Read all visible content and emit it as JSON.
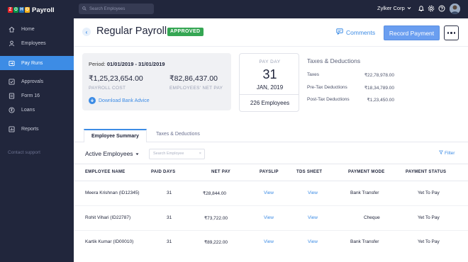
{
  "brand": {
    "logo_letters": [
      "Z",
      "O",
      "H",
      "O"
    ],
    "logo_colors": [
      "#e42527",
      "#089949",
      "#226db4",
      "#f9b21d"
    ],
    "product": "Payroll"
  },
  "sidebar": {
    "items": [
      {
        "label": "Home",
        "icon": "home-icon"
      },
      {
        "label": "Employees",
        "icon": "user-icon"
      },
      {
        "label": "Pay Runs",
        "icon": "payrun-icon",
        "active": true
      },
      {
        "label": "Approvals",
        "icon": "checkbox-icon"
      },
      {
        "label": "Form 16",
        "icon": "document-icon"
      },
      {
        "label": "Loans",
        "icon": "rupee-icon"
      },
      {
        "label": "Reports",
        "icon": "chart-icon"
      }
    ],
    "contact": "Contact support"
  },
  "topbar": {
    "search_placeholder": "Search Employees",
    "org_name": "Zylker Corp"
  },
  "header": {
    "title": "Regular Payroll",
    "status": "APPROVED",
    "comments": "Comments",
    "record_payment": "Record Payment"
  },
  "summary": {
    "period_label": "Period:",
    "period_value": "01/01/2019 - 31/01/2019",
    "payroll_cost": "₹1,25,23,654.00",
    "payroll_cost_label": "PAYROLL COST",
    "net_pay": "₹82,86,437.00",
    "net_pay_label": "EMPLOYEES' NET PAY",
    "download_advice": "Download Bank Advice"
  },
  "payday": {
    "label": "PAY DAY",
    "day": "31",
    "month_year": "JAN, 2019",
    "employees": "226 Employees"
  },
  "taxes": {
    "title": "Taxes & Deductions",
    "rows": [
      {
        "label": "Taxes",
        "value": "₹22,78,978.00"
      },
      {
        "label": "Pre-Tax Deductions",
        "value": "₹18,34,789.00"
      },
      {
        "label": "Post-Tax Deductions",
        "value": "₹1,23,450.00"
      }
    ]
  },
  "tabs": [
    "Employee Summary",
    "Taxes & Deductions"
  ],
  "filter_bar": {
    "dropdown": "Active Employees",
    "search_placeholder": "Search Employee",
    "filter": "Filter"
  },
  "table": {
    "headers": [
      "EMPLOYEE NAME",
      "PAID DAYS",
      "NET PAY",
      "PAYSLIP",
      "TDS SHEET",
      "PAYMENT MODE",
      "PAYMENT STATUS"
    ],
    "rows": [
      {
        "name": "Meera Krishnan (ID12345)",
        "paid_days": "31",
        "net_pay": "₹28,844.00",
        "payslip": "View",
        "tds": "View",
        "mode": "Bank Transfer",
        "status": "Yet To Pay"
      },
      {
        "name": "Rohit Vihari (ID22787)",
        "paid_days": "31",
        "net_pay": "₹73,722.00",
        "payslip": "View",
        "tds": "View",
        "mode": "Cheque",
        "status": "Yet To Pay"
      },
      {
        "name": "Kartik Kumar (ID00010)",
        "paid_days": "31",
        "net_pay": "₹89,222.00",
        "payslip": "View",
        "tds": "View",
        "mode": "Bank Transfer",
        "status": "Yet To Pay"
      }
    ]
  }
}
